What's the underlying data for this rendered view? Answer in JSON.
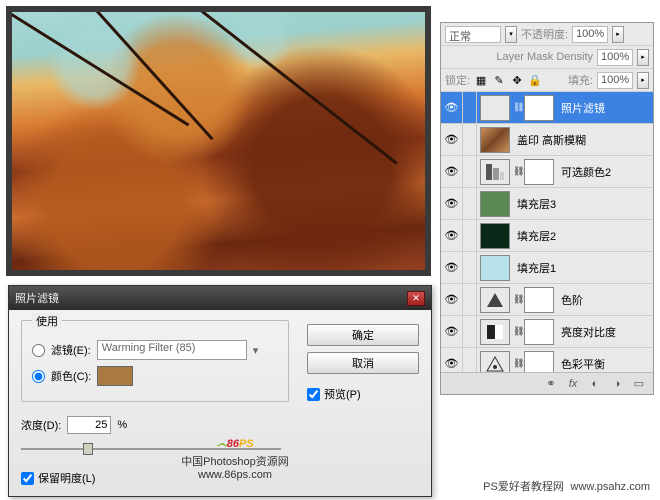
{
  "canvas": {
    "alt": "Autumn leaves photo"
  },
  "layersPanel": {
    "blendMode": "正常",
    "opacityLabel": "不透明度:",
    "opacityValue": "100%",
    "maskDensityLabel": "Layer Mask Density",
    "maskDensityValue": "100%",
    "lockLabel": "锁定:",
    "fillLabel": "填充:",
    "fillValue": "100%",
    "layers": [
      {
        "name": "照片滤镜",
        "thumbType": "photo-filter",
        "selected": true
      },
      {
        "name": "盖印 高斯模糊",
        "thumbType": "blur"
      },
      {
        "name": "可选颜色2",
        "thumbType": "selective-color"
      },
      {
        "name": "填充层3",
        "thumbType": "fill-green"
      },
      {
        "name": "填充层2",
        "thumbType": "fill-dark"
      },
      {
        "name": "填充层1",
        "thumbType": "fill-light"
      },
      {
        "name": "色阶",
        "thumbType": "levels"
      },
      {
        "name": "亮度对比度",
        "thumbType": "brightness"
      },
      {
        "name": "色彩平衡",
        "thumbType": "color-balance"
      }
    ]
  },
  "dialog": {
    "title": "照片滤镜",
    "useLegend": "使用",
    "filterRadio": "滤镜(E):",
    "filterValue": "Warming Filter (85)",
    "colorRadio": "颜色(C):",
    "colorSwatch": "#a97a42",
    "densityLabel": "浓度(D):",
    "densityValue": "25",
    "densityUnit": "%",
    "preserveLabel": "保留明度(L)",
    "okBtn": "确定",
    "cancelBtn": "取消",
    "previewLabel": "预览(P)"
  },
  "watermarks": {
    "logo86": "86",
    "logoPS": "PS",
    "site86": "中国Photoshop资源网",
    "url86": "www.86ps.com",
    "site2": "PS爱好者教程网",
    "url2": "www.psahz.com"
  }
}
